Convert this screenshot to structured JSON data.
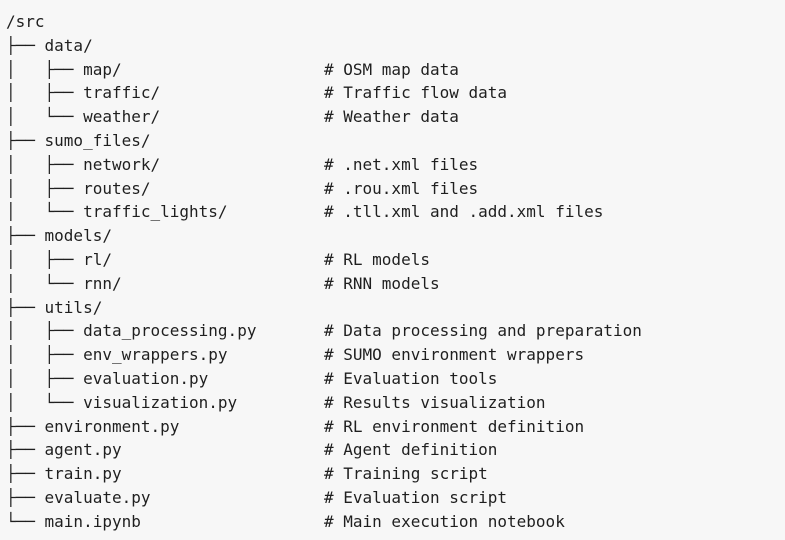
{
  "code_block": {
    "lines": [
      {
        "prefix": "",
        "name": "/src",
        "comment": ""
      },
      {
        "prefix": "├── ",
        "name": "data/",
        "comment": ""
      },
      {
        "prefix": "│   ├── ",
        "name": "map/",
        "comment": "# OSM map data"
      },
      {
        "prefix": "│   ├── ",
        "name": "traffic/",
        "comment": "# Traffic flow data"
      },
      {
        "prefix": "│   └── ",
        "name": "weather/",
        "comment": "# Weather data"
      },
      {
        "prefix": "├── ",
        "name": "sumo_files/",
        "comment": ""
      },
      {
        "prefix": "│   ├── ",
        "name": "network/",
        "comment": "# .net.xml files"
      },
      {
        "prefix": "│   ├── ",
        "name": "routes/",
        "comment": "# .rou.xml files"
      },
      {
        "prefix": "│   └── ",
        "name": "traffic_lights/",
        "comment": "# .tll.xml and .add.xml files"
      },
      {
        "prefix": "├── ",
        "name": "models/",
        "comment": ""
      },
      {
        "prefix": "│   ├── ",
        "name": "rl/",
        "comment": "# RL models"
      },
      {
        "prefix": "│   └── ",
        "name": "rnn/",
        "comment": "# RNN models"
      },
      {
        "prefix": "├── ",
        "name": "utils/",
        "comment": ""
      },
      {
        "prefix": "│   ├── ",
        "name": "data_processing.py",
        "comment": "# Data processing and preparation"
      },
      {
        "prefix": "│   ├── ",
        "name": "env_wrappers.py",
        "comment": "# SUMO environment wrappers"
      },
      {
        "prefix": "│   ├── ",
        "name": "evaluation.py",
        "comment": "# Evaluation tools"
      },
      {
        "prefix": "│   └── ",
        "name": "visualization.py",
        "comment": "# Results visualization"
      },
      {
        "prefix": "├── ",
        "name": "environment.py",
        "comment": "# RL environment definition"
      },
      {
        "prefix": "├── ",
        "name": "agent.py",
        "comment": "# Agent definition"
      },
      {
        "prefix": "├── ",
        "name": "train.py",
        "comment": "# Training script"
      },
      {
        "prefix": "├── ",
        "name": "evaluate.py",
        "comment": "# Evaluation script"
      },
      {
        "prefix": "└── ",
        "name": "main.ipynb",
        "comment": "# Main execution notebook"
      }
    ]
  }
}
